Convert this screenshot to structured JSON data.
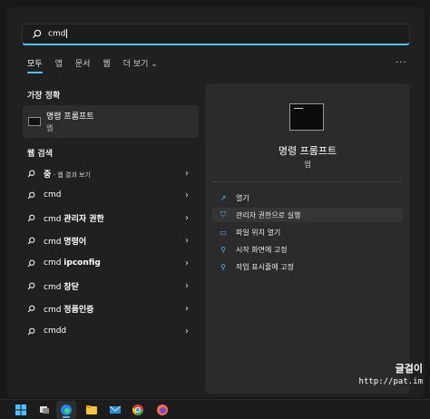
{
  "search": {
    "value": "cmd"
  },
  "tabs": [
    {
      "label": "모두",
      "active": true
    },
    {
      "label": "앱"
    },
    {
      "label": "문서"
    },
    {
      "label": "웹"
    },
    {
      "label": "더 보기",
      "has_dropdown": true
    }
  ],
  "more_menu": "···",
  "best_match": {
    "section_title": "가장 정확",
    "title": "명령 프롬프트",
    "subtitle": "앱"
  },
  "web_search": {
    "section_title": "웹 검색",
    "items": [
      {
        "prefix": "",
        "bold": "중",
        "suffix": " - 웹 결과 보기"
      },
      {
        "prefix": "cmd",
        "bold": "",
        "suffix": ""
      },
      {
        "prefix": "cmd ",
        "bold": "관리자 권한",
        "suffix": ""
      },
      {
        "prefix": "cmd ",
        "bold": "명령어",
        "suffix": ""
      },
      {
        "prefix": "cmd ",
        "bold": "ipconfig",
        "suffix": ""
      },
      {
        "prefix": "cmd ",
        "bold": "창닫",
        "suffix": ""
      },
      {
        "prefix": "cmd ",
        "bold": "정품인증",
        "suffix": ""
      },
      {
        "prefix": "cmdd",
        "bold": "",
        "suffix": ""
      }
    ]
  },
  "detail": {
    "title": "명령 프롬프트",
    "subtitle": "앱",
    "actions": [
      {
        "label": "열기",
        "icon": "open-icon"
      },
      {
        "label": "관리자 권한으로 실행",
        "icon": "shield-icon",
        "highlighted": true
      },
      {
        "label": "파일 위치 열기",
        "icon": "folder-icon"
      },
      {
        "label": "시작 화면에 고정",
        "icon": "pin-icon"
      },
      {
        "label": "작업 표시줄에 고정",
        "icon": "pin-icon"
      }
    ]
  },
  "watermark": {
    "line1": "글걸이",
    "line2": "http://pat.im"
  },
  "colors": {
    "accent": "#4cc2ff",
    "background": "#202020",
    "panel": "#2b2b2b"
  }
}
